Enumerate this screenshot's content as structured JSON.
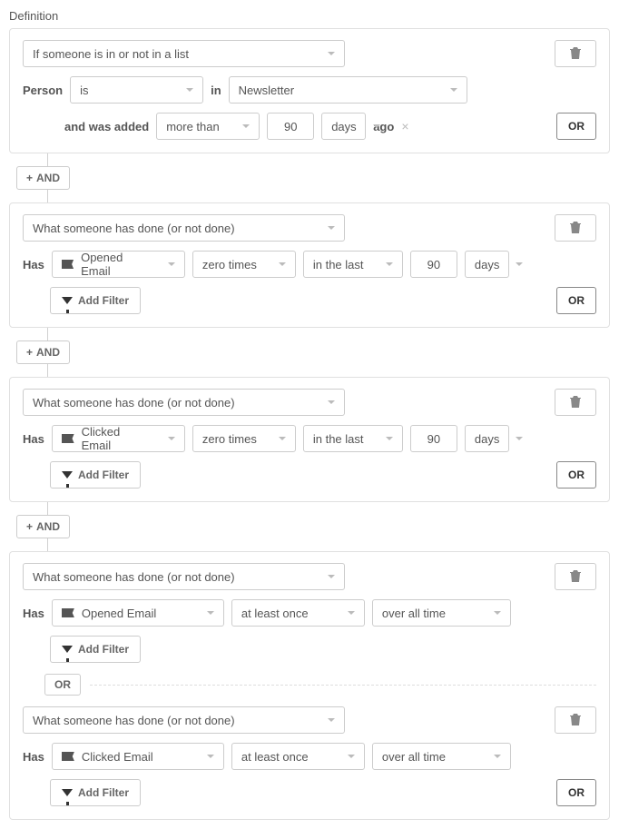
{
  "labels": {
    "definition": "Definition",
    "and": "AND",
    "or": "OR",
    "person": "Person",
    "in": "in",
    "and_was_added": "and was added",
    "ago": "ago",
    "has": "Has",
    "add_filter": "Add Filter"
  },
  "rule_types": {
    "in_list": "If someone is in or not in a list",
    "done": "What someone has done (or not done)"
  },
  "groups": [
    {
      "type": "in_list",
      "person_op": "is",
      "list": "Newsletter",
      "added_op": "more than",
      "added_value": "90",
      "added_unit": "days"
    },
    {
      "type": "done",
      "conditions": [
        {
          "metric": "Opened Email",
          "count_op": "zero times",
          "range_op": "in the last",
          "range_value": "90",
          "range_unit": "days"
        }
      ]
    },
    {
      "type": "done",
      "conditions": [
        {
          "metric": "Clicked Email",
          "count_op": "zero times",
          "range_op": "in the last",
          "range_value": "90",
          "range_unit": "days"
        }
      ]
    },
    {
      "type": "done",
      "conditions": [
        {
          "metric": "Opened Email",
          "count_op": "at least once",
          "range_op": "over all time"
        },
        {
          "metric": "Clicked Email",
          "count_op": "at least once",
          "range_op": "over all time"
        }
      ]
    }
  ]
}
